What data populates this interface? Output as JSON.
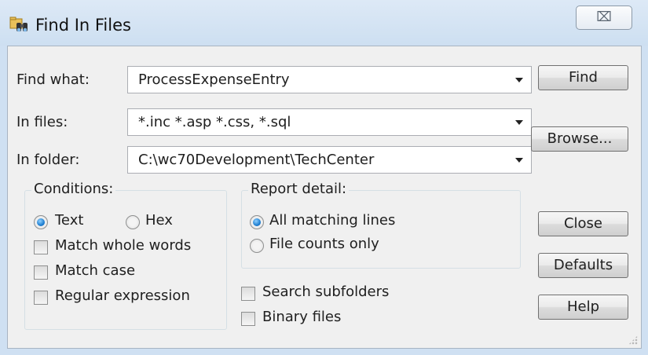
{
  "window": {
    "title": "Find In Files",
    "close_glyph": "⌧",
    "icon": "binoculars-folder-icon"
  },
  "fields": {
    "find_what": {
      "label": "Find what:",
      "value": "ProcessExpenseEntry"
    },
    "in_files": {
      "label": "In files:",
      "value": "*.inc  *.asp *.css, *.sql"
    },
    "in_folder": {
      "label": "In folder:",
      "value": "C:\\wc70Development\\TechCenter"
    }
  },
  "buttons": {
    "find": "Find",
    "browse": "Browse...",
    "close": "Close",
    "defaults": "Defaults",
    "help": "Help"
  },
  "conditions": {
    "title": "Conditions:",
    "text_label": "Text",
    "text_checked": true,
    "hex_label": "Hex",
    "hex_checked": false,
    "match_whole_words": "Match whole words",
    "match_whole_words_checked": false,
    "match_case": "Match case",
    "match_case_checked": false,
    "regular_expression": "Regular expression",
    "regular_expression_checked": false
  },
  "report": {
    "title": "Report detail:",
    "all_matching_lines": "All matching lines",
    "all_matching_lines_checked": true,
    "file_counts_only": "File counts only",
    "file_counts_only_checked": false
  },
  "options": {
    "search_subfolders": "Search subfolders",
    "search_subfolders_checked": false,
    "binary_files": "Binary files",
    "binary_files_checked": false
  }
}
